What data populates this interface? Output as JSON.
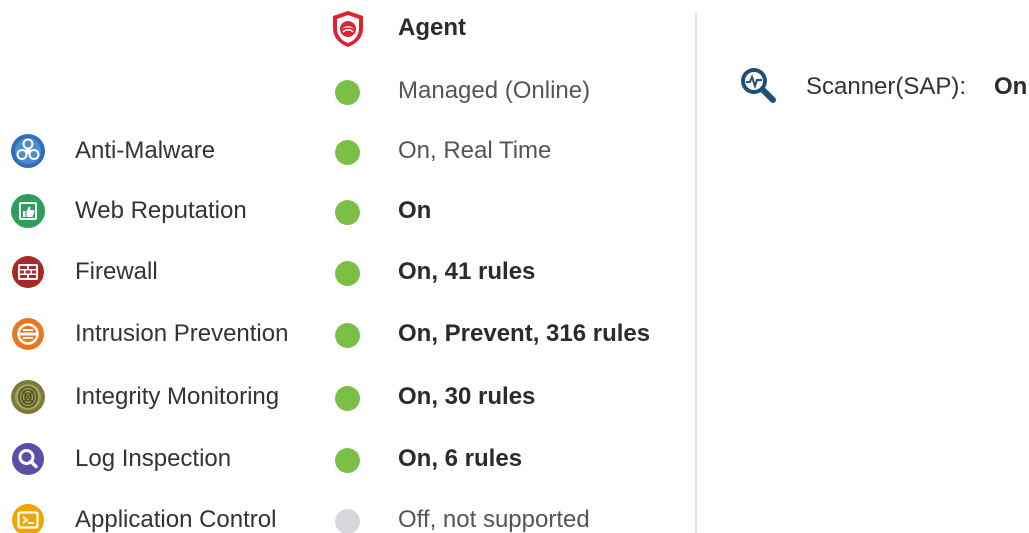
{
  "agent": {
    "label": "Agent",
    "icon": "trend-micro-shield-icon",
    "icon_color": "#e0222e"
  },
  "agent_status": {
    "status": "Managed (Online)",
    "dot_color": "#7cbf46"
  },
  "modules": [
    {
      "name": "Anti-Malware",
      "icon": "biohazard-icon",
      "icon_color": "#2f6fb6",
      "status": "On, Real Time",
      "status_weight": "normal",
      "dot_color": "#7cbf46"
    },
    {
      "name": "Web Reputation",
      "icon": "thumbs-up-icon",
      "icon_color": "#2e9e5b",
      "status": "On",
      "status_weight": "bold",
      "dot_color": "#7cbf46"
    },
    {
      "name": "Firewall",
      "icon": "brick-wall-icon",
      "icon_color": "#a52a2a",
      "status": "On, 41 rules",
      "status_weight": "bold",
      "dot_color": "#7cbf46"
    },
    {
      "name": "Intrusion Prevention",
      "icon": "shield-stop-icon",
      "icon_color": "#e87722",
      "status": "On, Prevent, 316 rules",
      "status_weight": "bold",
      "dot_color": "#7cbf46"
    },
    {
      "name": "Integrity Monitoring",
      "icon": "fingerprint-icon",
      "icon_color": "#7a7a3a",
      "status": "On, 30 rules",
      "status_weight": "bold",
      "dot_color": "#7cbf46"
    },
    {
      "name": "Log Inspection",
      "icon": "magnifier-icon",
      "icon_color": "#5b4ea8",
      "status": "On, 6 rules",
      "status_weight": "bold",
      "dot_color": "#7cbf46"
    },
    {
      "name": "Application Control",
      "icon": "application-window-icon",
      "icon_color": "#f0a500",
      "status": "Off, not supported",
      "status_weight": "normal",
      "dot_color": "#d6d8dc"
    }
  ],
  "scanner": {
    "label": "Scanner(SAP):",
    "value": "On",
    "icon": "scan-magnifier-icon",
    "icon_color": "#1f4e79"
  }
}
